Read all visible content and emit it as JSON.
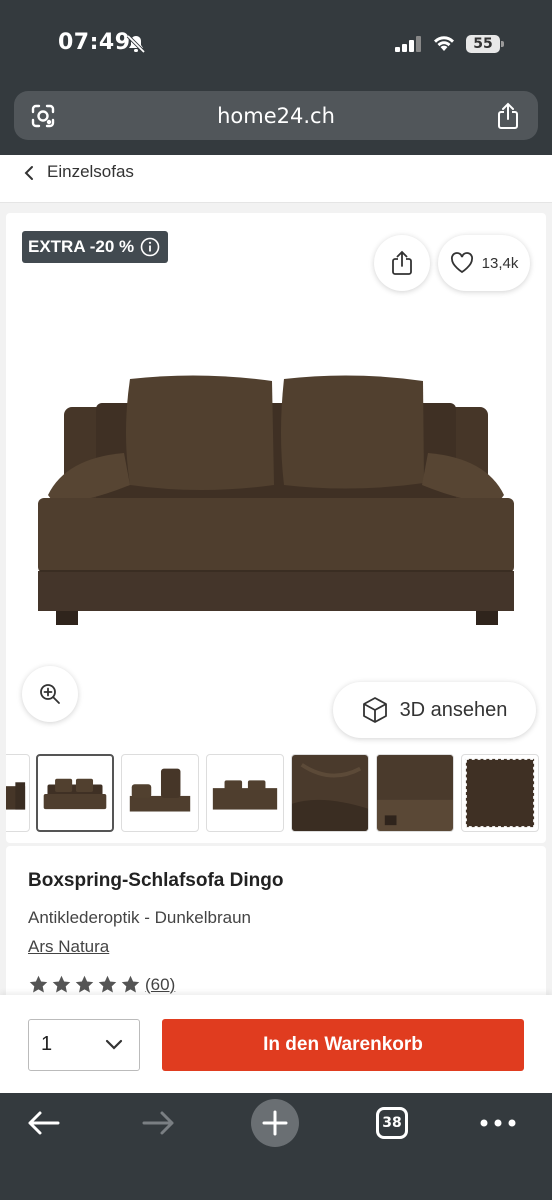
{
  "status_bar": {
    "time": "07:49",
    "battery": "55"
  },
  "browser": {
    "url": "home24.ch",
    "tab_count": "38"
  },
  "breadcrumb": {
    "label": "Einzelsofas"
  },
  "gallery": {
    "badge": "EXTRA -20 %",
    "wishlist_count": "13,4k",
    "view_3d_label": "3D ansehen",
    "thumbnail_count": 7,
    "selected_thumbnail": 2
  },
  "product": {
    "title": "Boxspring-Schlafsofa Dingo",
    "variant": "Antiklederoptik - Dunkelbraun",
    "brand": "Ars Natura",
    "rating_stars": 5,
    "review_count": "(60)"
  },
  "cart": {
    "quantity": "1",
    "add_label": "In den Warenkorb"
  },
  "colors": {
    "brand_red": "#e03c1f",
    "chrome": "#343a3e",
    "sofa_brown": "#4a3a2c"
  }
}
